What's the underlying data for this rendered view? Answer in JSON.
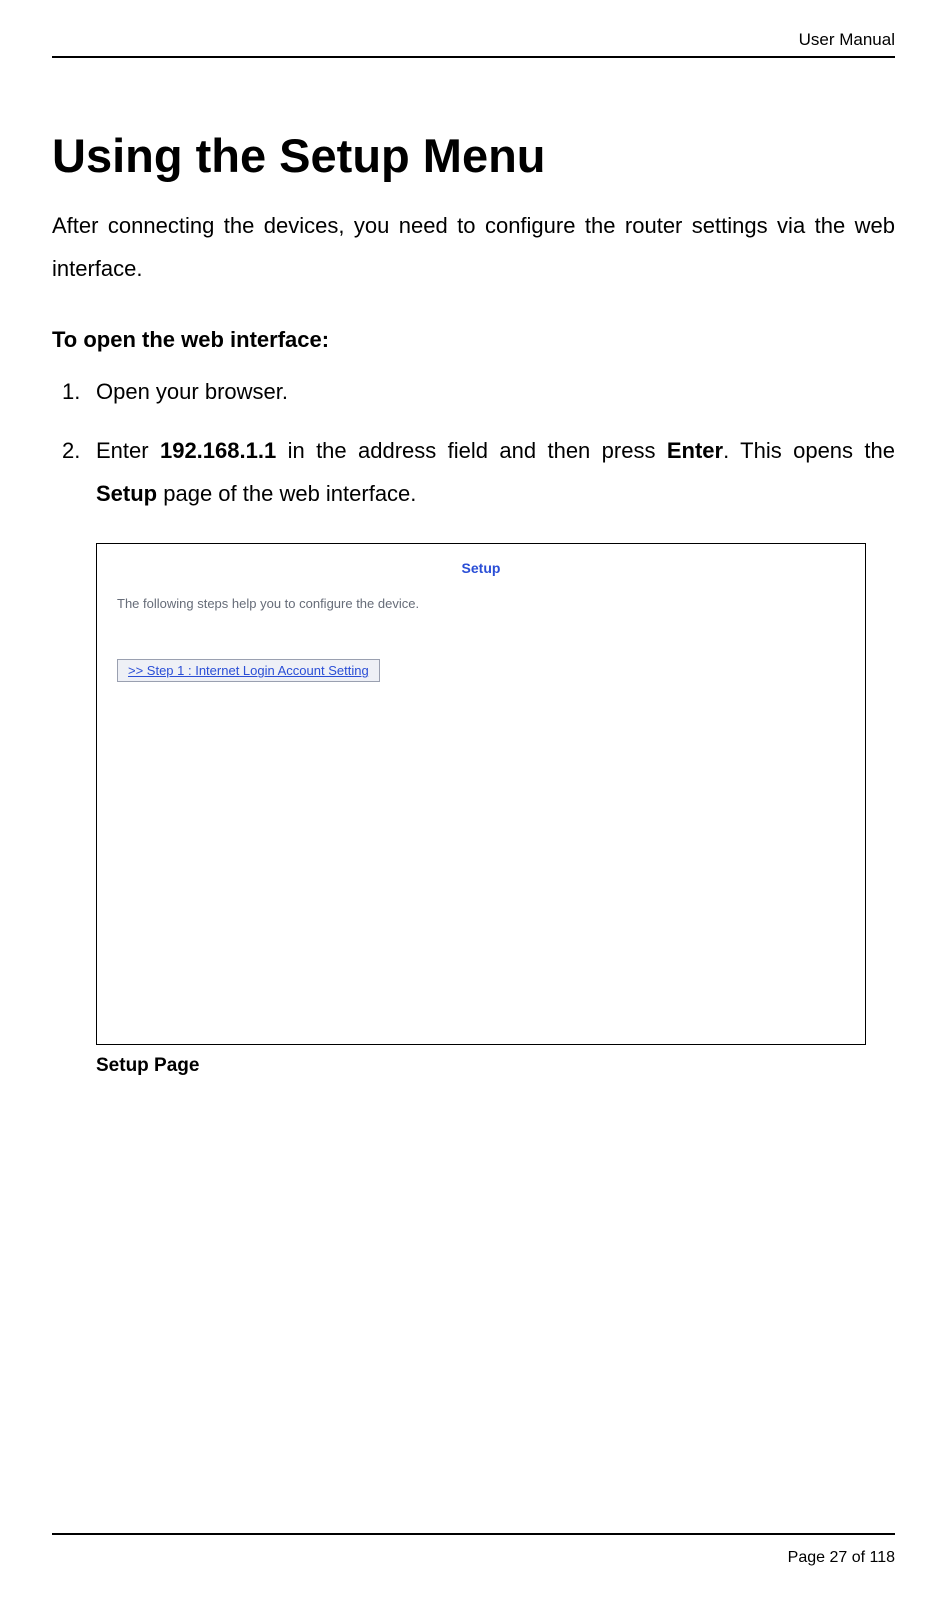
{
  "header": {
    "doc_name": "User Manual"
  },
  "title": "Using the Setup Menu",
  "intro": "After connecting the devices, you need to configure the router settings via the web interface.",
  "subhead": "To open the web interface:",
  "steps": {
    "s1": "Open your browser.",
    "s2a": "Enter ",
    "s2_ip": "192.168.1.1",
    "s2b": " in the address field and then press ",
    "s2_enter": "Enter",
    "s2c": ". This opens the ",
    "s2_setup": "Setup",
    "s2d": " page of the web interface."
  },
  "screenshot": {
    "title": "Setup",
    "helper": "The following steps help you to configure the device.",
    "button": ">> Step 1 : Internet Login Account Setting"
  },
  "caption": "Setup Page",
  "footer": {
    "prefix": "Page ",
    "current": "27",
    "of": " of ",
    "total": "118"
  }
}
